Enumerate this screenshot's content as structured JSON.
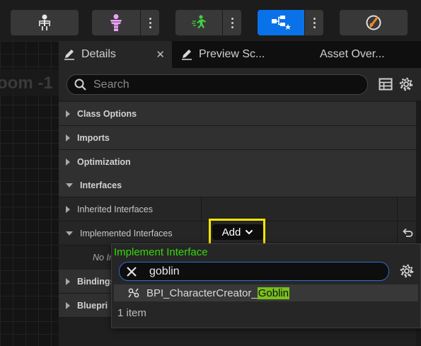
{
  "toolbar": {
    "buttons": [
      {
        "icon": "skeleton-icon"
      },
      {
        "icon": "mesh-figure-icon"
      },
      {
        "icon": "running-man-icon"
      },
      {
        "icon": "blueprint-graph-icon",
        "active": true
      },
      {
        "icon": "physics-icon"
      }
    ]
  },
  "viewport": {
    "overlay_text": "oom -1"
  },
  "tabs": {
    "details": "Details",
    "preview": "Preview Sc...",
    "asset": "Asset Over..."
  },
  "search": {
    "placeholder": "Search"
  },
  "categories": {
    "class_options": "Class Options",
    "imports": "Imports",
    "optimization": "Optimization",
    "interfaces": "Interfaces"
  },
  "properties": {
    "inherited": "Inherited Interfaces",
    "implemented": "Implemented Interfaces",
    "no_items": "No In"
  },
  "hidden_categories": {
    "bindings": "Bindings",
    "blueprint": "Bluepri"
  },
  "add_button": {
    "label": "Add"
  },
  "popup": {
    "title": "Implement Interface",
    "search_value": "goblin",
    "result_prefix": "BPI_CharacterCreator_",
    "result_match": "Goblin",
    "count": "1 item"
  },
  "colors": {
    "accent": "#0a72e8",
    "highlight_box": "#f3e600",
    "popup_title": "#35d80b",
    "match_highlight": "#79c01c"
  }
}
